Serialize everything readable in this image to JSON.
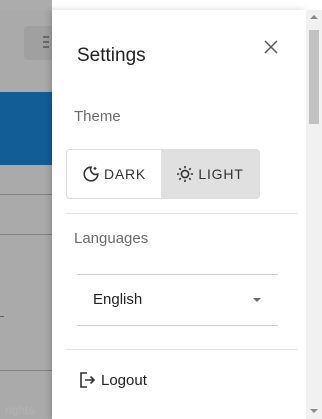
{
  "background": {
    "footer_text": "rights",
    "accent_color": "#1a87d5"
  },
  "drawer": {
    "title": "Settings",
    "close_icon": "close-icon",
    "theme": {
      "label": "Theme",
      "options": [
        {
          "label": "DARK",
          "icon": "dark-mode-icon",
          "selected": false
        },
        {
          "label": "LIGHT",
          "icon": "light-mode-icon",
          "selected": true
        }
      ]
    },
    "languages": {
      "label": "Languages",
      "selected": "English"
    },
    "logout": {
      "label": "Logout",
      "icon": "logout-icon"
    }
  }
}
